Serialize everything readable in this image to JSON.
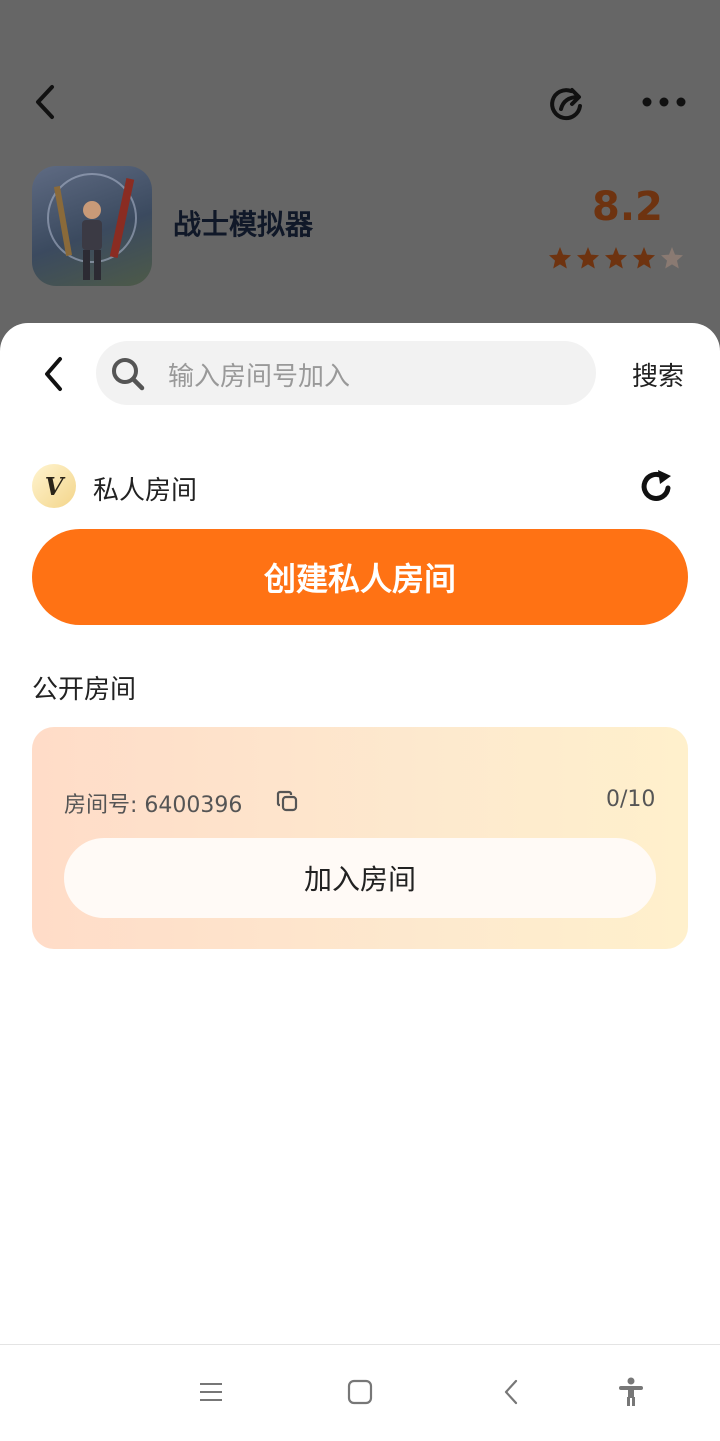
{
  "header": {
    "back_icon": "chevron-left-icon",
    "share_icon": "share-icon",
    "more_icon": "more-dots-icon"
  },
  "game": {
    "title": "战士模拟器",
    "rating": "8.2",
    "stars_filled": 4,
    "stars_total": 5,
    "rating_color": "#6e3310",
    "star_filled_color": "#6e3310",
    "star_empty_color": "#8a7a72"
  },
  "search": {
    "placeholder": "输入房间号加入",
    "search_label": "搜索"
  },
  "private": {
    "badge": "V",
    "title": "私人房间",
    "refresh_icon": "refresh-icon",
    "create_label": "创建私人房间",
    "accent": "#ff7214"
  },
  "public": {
    "title": "公开房间",
    "rooms": [
      {
        "room_label": "房间号: 6400396",
        "count": "0/10",
        "join_label": "加入房间"
      }
    ]
  },
  "navbar": {
    "items": [
      "menu-icon",
      "home-square-icon",
      "back-icon",
      "accessibility-icon"
    ]
  }
}
